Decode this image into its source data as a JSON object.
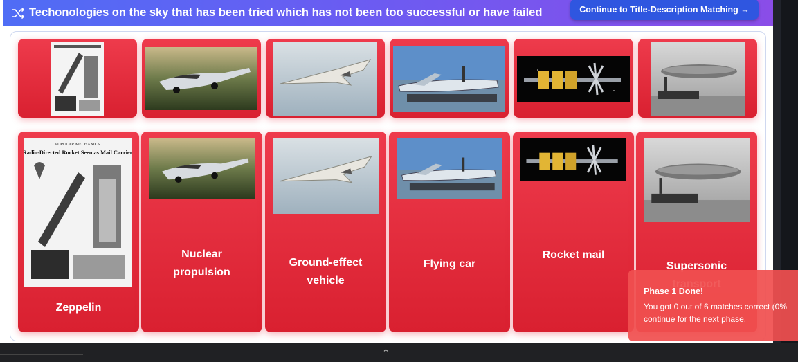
{
  "header": {
    "title": "Techonologies on the sky that has been tried which has not been too successful or have failed",
    "continue_label": "Continue to Title-Description Matching →"
  },
  "top_row": [
    {
      "image": "rocket-mail-newspaper-clipping"
    },
    {
      "image": "flying-car-photo"
    },
    {
      "image": "supersonic-jet-photo"
    },
    {
      "image": "ground-effect-vehicle-photo"
    },
    {
      "image": "nuclear-propulsion-spacecraft-render"
    },
    {
      "image": "zeppelin-airship-photo"
    }
  ],
  "bottom_row": [
    {
      "image": "rocket-mail-newspaper-clipping",
      "label": "Zeppelin"
    },
    {
      "image": "flying-car-photo",
      "label": "Nuclear propulsion"
    },
    {
      "image": "supersonic-jet-photo",
      "label": "Ground-effect vehicle"
    },
    {
      "image": "ground-effect-vehicle-photo",
      "label": "Flying car"
    },
    {
      "image": "nuclear-propulsion-spacecraft-render",
      "label": "Rocket mail"
    },
    {
      "image": "zeppelin-airship-photo",
      "label": "Supersonic transport"
    }
  ],
  "newspaper": {
    "masthead": "POPULAR MECHANICS",
    "headline": "Radio-Directed Rocket Seen as Mail Carrier"
  },
  "toast": {
    "title": "Phase 1 Done!",
    "line1": "You got 0 out of 6 matches correct (0%",
    "line2": "continue for the next phase."
  },
  "colors": {
    "tile_red": "#e52a3a",
    "header_start": "#4f6df5",
    "header_end": "#8a4de8",
    "button_blue": "#2f56e0",
    "toast_red": "#f05050"
  }
}
